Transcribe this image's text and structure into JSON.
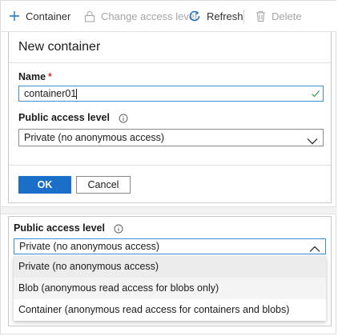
{
  "toolbar": {
    "container_label": "Container",
    "change_access_label": "Change access level",
    "refresh_label": "Refresh",
    "delete_label": "Delete"
  },
  "new_container": {
    "title": "New container",
    "name_label": "Name",
    "required_marker": "*",
    "name_value": "container01",
    "access_label": "Public access level",
    "access_value": "Private (no anonymous access)",
    "ok_label": "OK",
    "cancel_label": "Cancel"
  },
  "access_dropdown": {
    "label": "Public access level",
    "selected_value": "Private (no anonymous access)",
    "options": [
      "Private (no anonymous access)",
      "Blob (anonymous read access for blobs only)",
      "Container (anonymous read access for containers and blobs)"
    ]
  },
  "colors": {
    "accent": "#1a6fc9",
    "focus_border": "#3a8fd9",
    "required": "#d13438",
    "valid_check": "#2e9e44"
  }
}
